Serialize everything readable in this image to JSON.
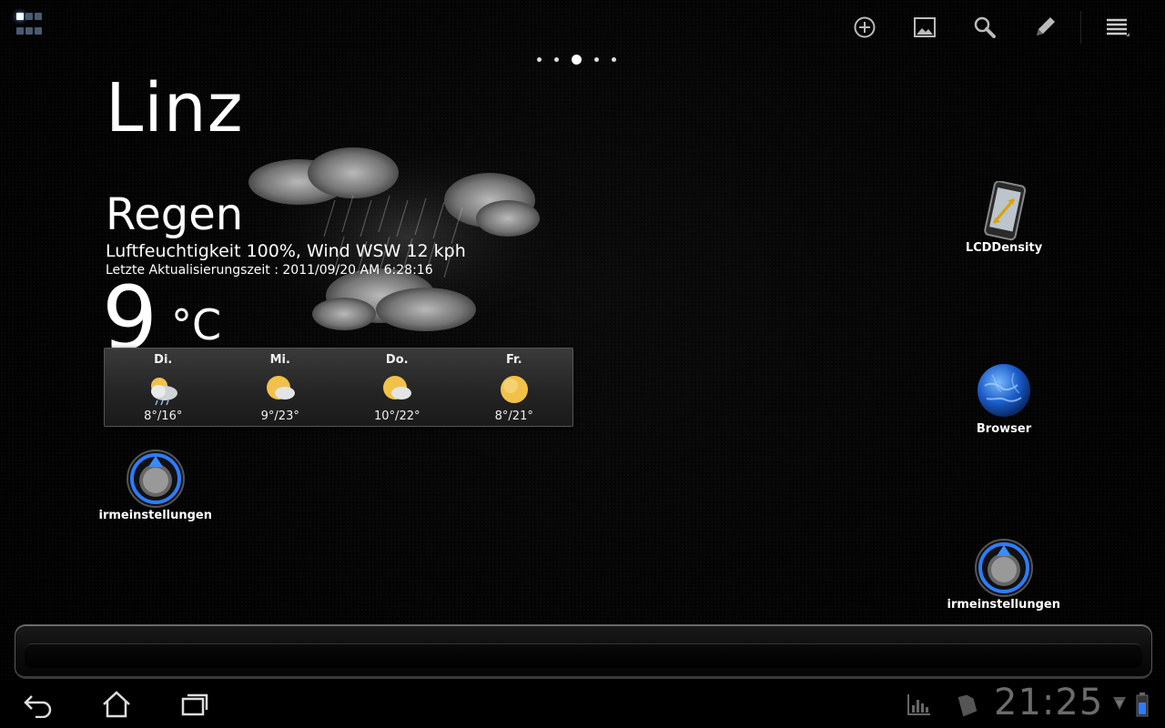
{
  "weather": {
    "city": "Linz",
    "condition": "Regen",
    "humidity_wind": "Luftfeuchtigkeit 100%, Wind WSW 12 kph",
    "last_update": "Letzte Aktualisierungszeit : 2011/09/20 AM 6:28:16",
    "temperature": "9",
    "unit": "°C",
    "forecast": [
      {
        "day": "Di.",
        "temp": "8°/16°",
        "icon": "cloudy-icon"
      },
      {
        "day": "Mi.",
        "temp": "9°/23°",
        "icon": "partly-cloudy-icon"
      },
      {
        "day": "Do.",
        "temp": "10°/22°",
        "icon": "partly-cloudy-icon"
      },
      {
        "day": "Fr.",
        "temp": "8°/21°",
        "icon": "sunny-icon"
      }
    ]
  },
  "desktop": {
    "lcddensity": "LCDDensity",
    "browser": "Browser",
    "screen_settings_left": "Bildschirmeinstellungen",
    "screen_settings_right": "Bildschirmeinstellungen"
  },
  "pager": {
    "count": 5,
    "active": 2
  },
  "status": {
    "clock": "21:25"
  },
  "icons": {
    "top_actions": [
      "add-icon",
      "wallpaper-icon",
      "search-icon",
      "edit-icon",
      "menu-icon"
    ],
    "nav": [
      "back-icon",
      "home-icon",
      "recent-apps-icon"
    ],
    "status": [
      "signal-bars-icon",
      "sd-card-icon",
      "wifi-icon",
      "battery-icon"
    ]
  },
  "colors": {
    "accent": "#3a8cff",
    "clock": "#6b6b6b"
  }
}
